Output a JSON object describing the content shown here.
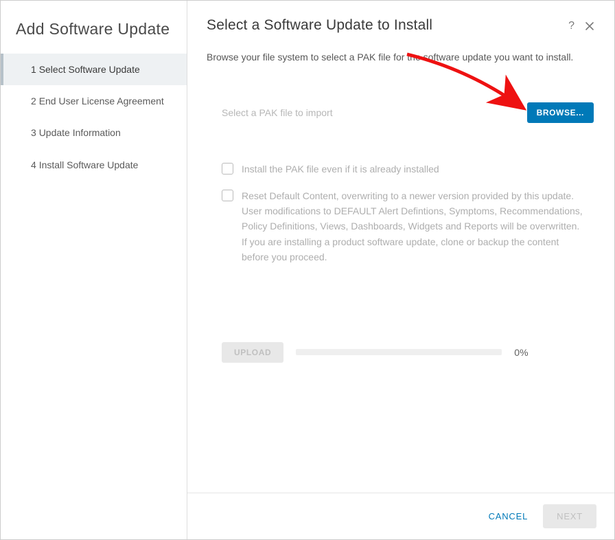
{
  "sidebar": {
    "title": "Add Software Update",
    "steps": [
      {
        "num": "1",
        "label": "Select Software Update",
        "active": true
      },
      {
        "num": "2",
        "label": "End User License Agreement",
        "active": false
      },
      {
        "num": "3",
        "label": "Update Information",
        "active": false
      },
      {
        "num": "4",
        "label": "Install Software Update",
        "active": false
      }
    ]
  },
  "main": {
    "title": "Select a Software Update to Install",
    "description": "Browse your file system to select a PAK file for the software update you want to install.",
    "file_placeholder": "Select a PAK file to import",
    "browse_label": "BROWSE...",
    "options": [
      {
        "label": "Install the PAK file even if it is already installed"
      },
      {
        "label": "Reset Default Content, overwriting to a newer version provided by this update. User modifications to DEFAULT Alert Defintions, Symptoms, Recommendations, Policy Definitions, Views, Dashboards, Widgets and Reports will be overwritten. If you are installing a product software update, clone or backup the content before you proceed."
      }
    ],
    "upload_label": "UPLOAD",
    "progress_text": "0%"
  },
  "footer": {
    "cancel_label": "CANCEL",
    "next_label": "NEXT"
  }
}
